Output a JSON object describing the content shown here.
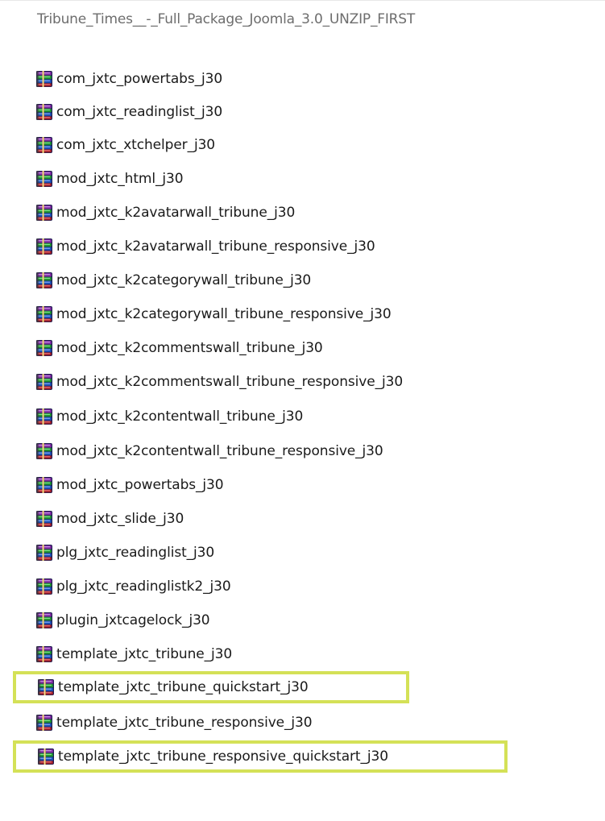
{
  "folder": {
    "title": "Tribune_Times__-_Full_Package_Joomla_3.0_UNZIP_FIRST"
  },
  "files": [
    {
      "name": "com_jxtc_powertabs_j30",
      "icon": "winrar-archive-icon",
      "highlighted": false
    },
    {
      "name": "com_jxtc_readinglist_j30",
      "icon": "winrar-archive-icon",
      "highlighted": false
    },
    {
      "name": "com_jxtc_xtchelper_j30",
      "icon": "winrar-archive-icon",
      "highlighted": false
    },
    {
      "name": "mod_jxtc_html_j30",
      "icon": "winrar-archive-icon",
      "highlighted": false
    },
    {
      "name": "mod_jxtc_k2avatarwall_tribune_j30",
      "icon": "winrar-archive-icon",
      "highlighted": false
    },
    {
      "name": "mod_jxtc_k2avatarwall_tribune_responsive_j30",
      "icon": "winrar-archive-icon",
      "highlighted": false
    },
    {
      "name": "mod_jxtc_k2categorywall_tribune_j30",
      "icon": "winrar-archive-icon",
      "highlighted": false
    },
    {
      "name": "mod_jxtc_k2categorywall_tribune_responsive_j30",
      "icon": "winrar-archive-icon",
      "highlighted": false
    },
    {
      "name": "mod_jxtc_k2commentswall_tribune_j30",
      "icon": "winrar-archive-icon",
      "highlighted": false
    },
    {
      "name": "mod_jxtc_k2commentswall_tribune_responsive_j30",
      "icon": "winrar-archive-icon",
      "highlighted": false
    },
    {
      "name": "mod_jxtc_k2contentwall_tribune_j30",
      "icon": "winrar-archive-icon",
      "highlighted": false
    },
    {
      "name": "mod_jxtc_k2contentwall_tribune_responsive_j30",
      "icon": "winrar-archive-icon",
      "highlighted": false
    },
    {
      "name": "mod_jxtc_powertabs_j30",
      "icon": "winrar-archive-icon",
      "highlighted": false
    },
    {
      "name": "mod_jxtc_slide_j30",
      "icon": "winrar-archive-icon",
      "highlighted": false
    },
    {
      "name": "plg_jxtc_readinglist_j30",
      "icon": "winrar-archive-icon",
      "highlighted": false
    },
    {
      "name": "plg_jxtc_readinglistk2_j30",
      "icon": "winrar-archive-icon",
      "highlighted": false
    },
    {
      "name": "plugin_jxtcagelock_j30",
      "icon": "winrar-archive-icon",
      "highlighted": false
    },
    {
      "name": "template_jxtc_tribune_j30",
      "icon": "winrar-archive-icon",
      "highlighted": false
    },
    {
      "name": "template_jxtc_tribune_quickstart_j30",
      "icon": "winrar-archive-icon",
      "highlighted": true
    },
    {
      "name": "template_jxtc_tribune_responsive_j30",
      "icon": "winrar-archive-icon",
      "highlighted": false
    },
    {
      "name": "template_jxtc_tribune_responsive_quickstart_j30",
      "icon": "winrar-archive-icon",
      "highlighted": true
    }
  ],
  "colors": {
    "highlight_border": "#d4e157",
    "text": "#1a1a1a",
    "title_text": "#6d6d6d"
  }
}
